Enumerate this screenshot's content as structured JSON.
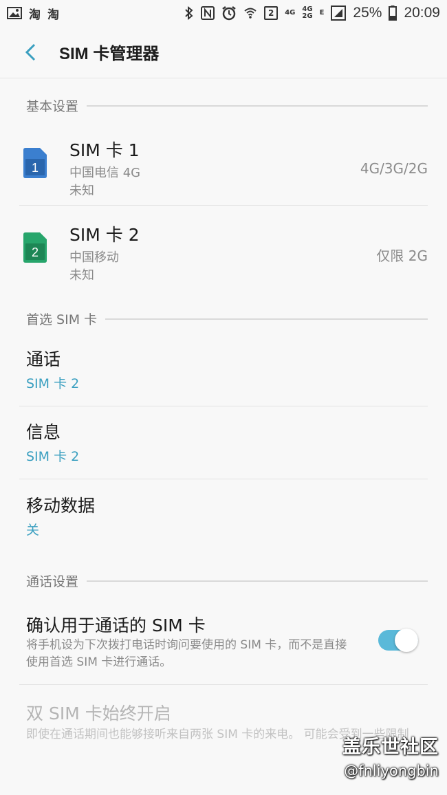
{
  "status_bar": {
    "app_icons": [
      "淘",
      "淘"
    ],
    "sim_slot_badge": "2",
    "net_sim1": "4G",
    "net_sim2_top": "4G",
    "net_sim2_bottom": "2G",
    "edge_label": "E",
    "battery": "25%",
    "time": "20:09"
  },
  "app_bar": {
    "title": "SIM 卡管理器"
  },
  "sections": {
    "basic": "基本设置",
    "preferred": "首选 SIM 卡",
    "call_settings": "通话设置"
  },
  "sims": [
    {
      "badge": "1",
      "name": "SIM 卡 1",
      "operator": "中国电信 4G",
      "status": "未知",
      "network": "4G/3G/2G",
      "color": "#3b7fcf",
      "color_dark": "#2a66ad"
    },
    {
      "badge": "2",
      "name": "SIM 卡 2",
      "operator": "中国移动",
      "status": "未知",
      "network": "仅限 2G",
      "color": "#27a56b",
      "color_dark": "#1d8655"
    }
  ],
  "preferred": {
    "call": {
      "title": "通话",
      "value": "SIM 卡 2"
    },
    "message": {
      "title": "信息",
      "value": "SIM 卡 2"
    },
    "mobile_data": {
      "title": "移动数据",
      "value": "关"
    }
  },
  "call_settings": {
    "confirm": {
      "title": "确认用于通话的 SIM 卡",
      "description": "将手机设为下次拨打电话时询问要使用的 SIM 卡，而不是直接使用首选 SIM 卡进行通话。",
      "enabled": true
    },
    "dual_always_on": {
      "title": "双 SIM 卡始终开启",
      "description": "即使在通话期间也能够接听来自两张 SIM 卡的来电。 可能会受到一些限制"
    }
  },
  "colors": {
    "accent": "#3a9fc0",
    "switch_on": "#5ab9d9"
  },
  "watermark": {
    "title": "盖乐世社区",
    "user": "@fnliyongbin"
  }
}
